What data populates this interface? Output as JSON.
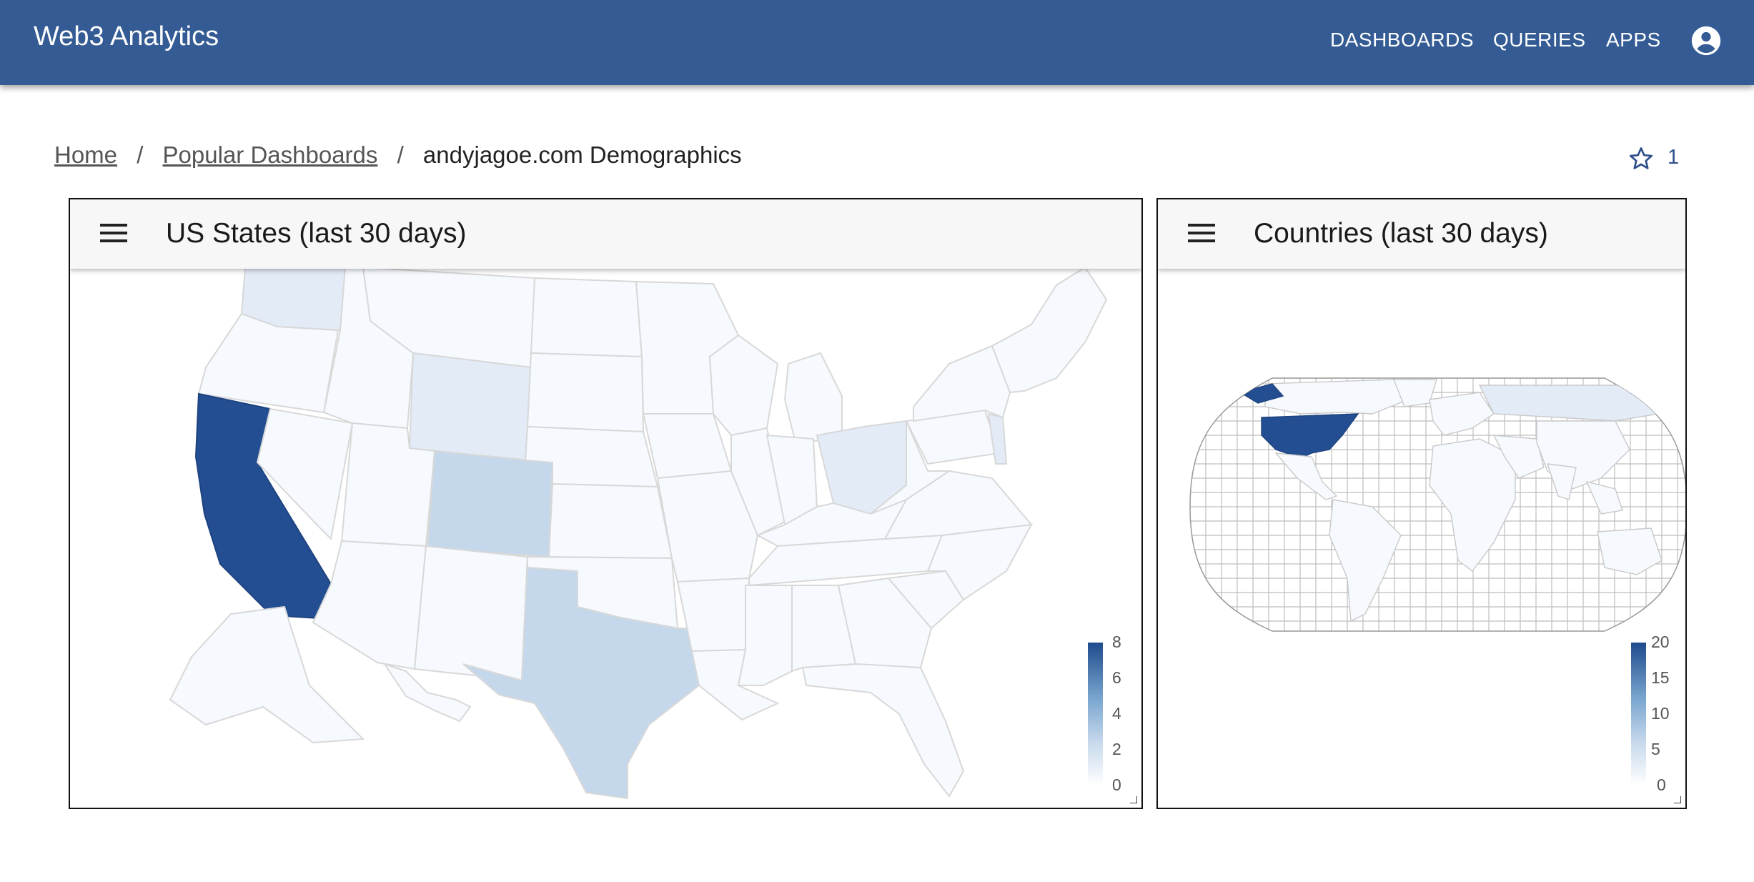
{
  "app": {
    "title": "Web3 Analytics",
    "nav": [
      "DASHBOARDS",
      "QUERIES",
      "APPS"
    ],
    "account_icon": "account-circle-icon"
  },
  "breadcrumb": {
    "home": "Home",
    "section": "Popular Dashboards",
    "current": "andyjagoe.com Demographics"
  },
  "favorites": {
    "icon": "star-outline-icon",
    "count": "1"
  },
  "panels": [
    {
      "title": "US States (last 30 days)",
      "menu_icon": "hamburger-menu-icon",
      "legend": [
        "8",
        "6",
        "4",
        "2",
        "0"
      ]
    },
    {
      "title": "Countries (last 30 days)",
      "menu_icon": "hamburger-menu-icon",
      "legend": [
        "20",
        "15",
        "10",
        "5",
        "0"
      ]
    }
  ],
  "colors": {
    "appbar": "#345b94",
    "high": "#234e91",
    "mid": "#c5d8eb",
    "low": "#e2ebf6",
    "none": "#f6f9fd",
    "border": "#d6d6d6"
  }
}
